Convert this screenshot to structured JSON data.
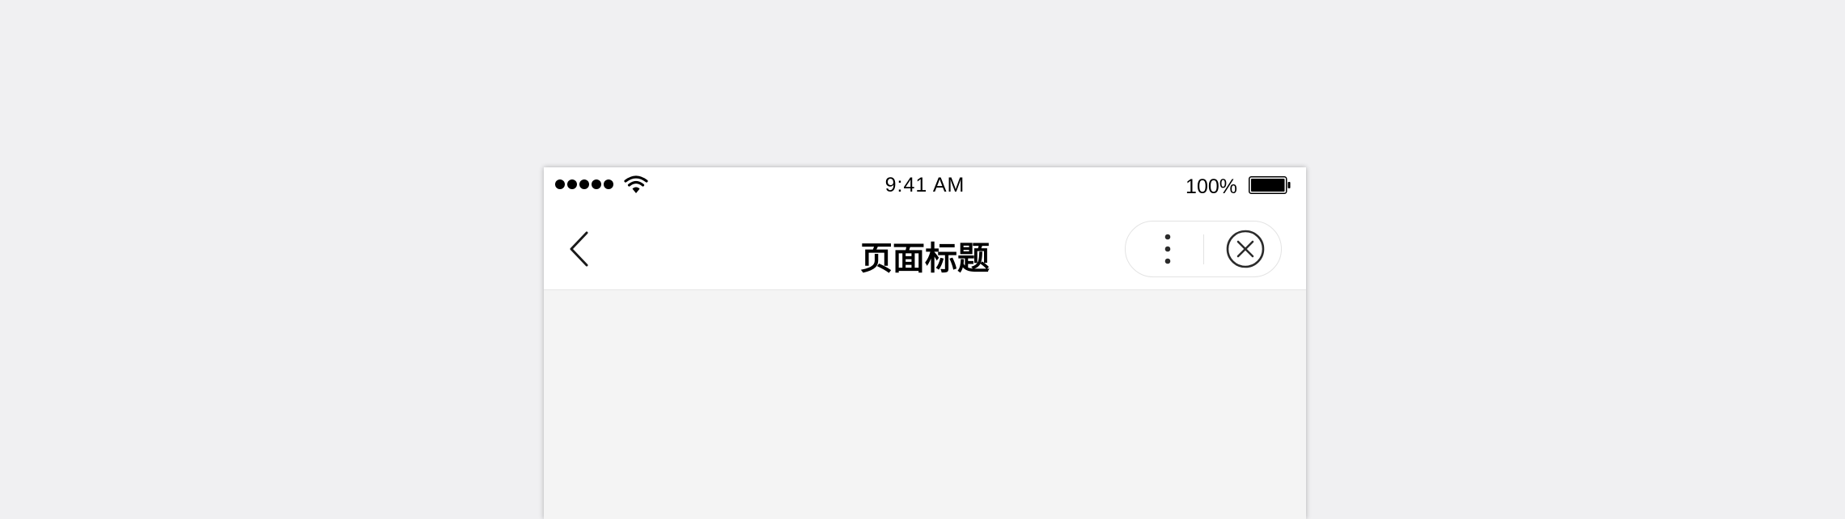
{
  "status_bar": {
    "time": "9:41 AM",
    "battery_percent": "100%",
    "battery_level": 1.0,
    "signal_strength": 5,
    "signal_icon": "signal-dots-icon",
    "wifi_icon": "wifi-icon",
    "battery_icon": "battery-icon"
  },
  "nav_bar": {
    "title": "页面标题",
    "back_icon": "chevron-left-icon",
    "more_icon": "more-vertical-icon",
    "close_icon": "close-circle-icon"
  }
}
